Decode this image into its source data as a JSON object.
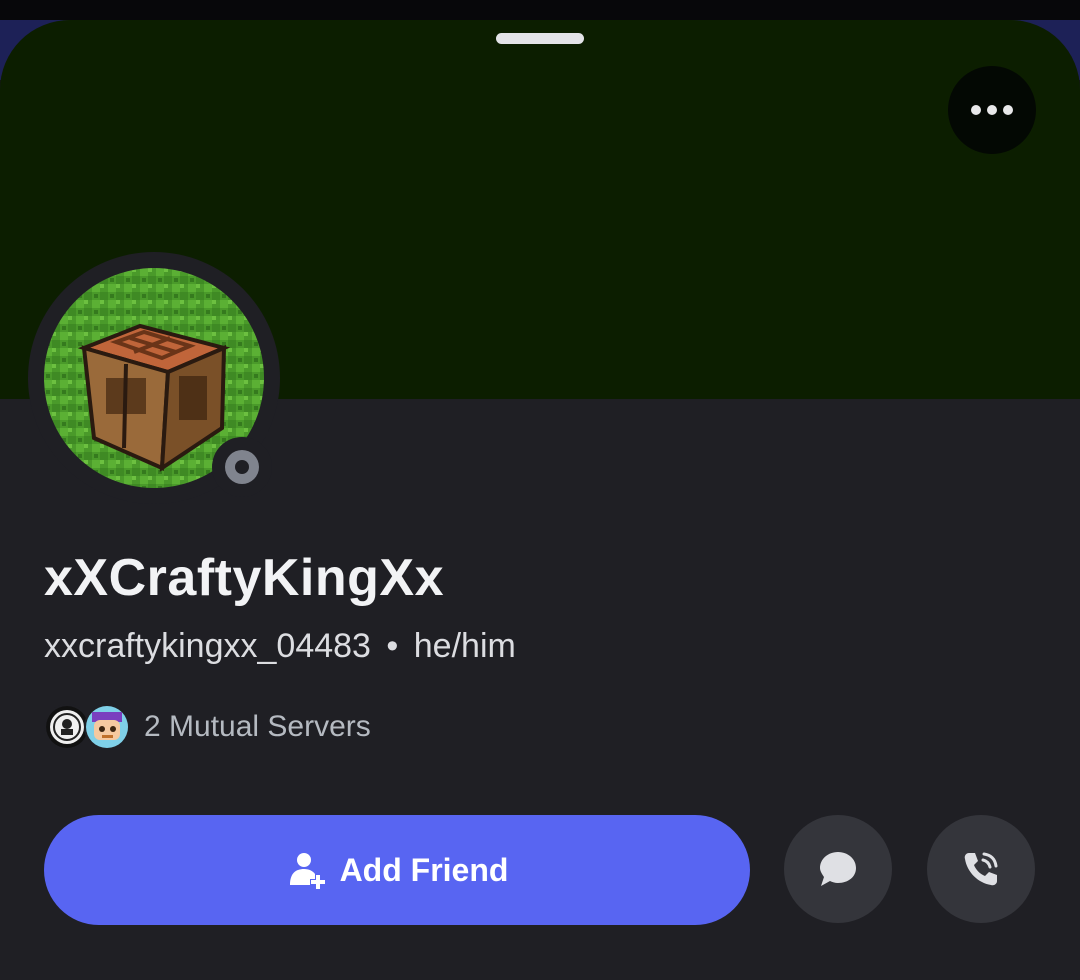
{
  "profile": {
    "display_name": "xXCraftyKingXx",
    "username": "xxcraftykingxx_04483",
    "separator": "•",
    "pronouns": "he/him",
    "status": "offline",
    "mutual_servers_text": "2 Mutual Servers"
  },
  "actions": {
    "add_friend_label": "Add Friend"
  },
  "colors": {
    "banner": "#0c1e00",
    "sheet": "#1f1f24",
    "primary_button": "#5865f2",
    "round_button": "#34353b",
    "status_offline": "#80848e"
  },
  "icons": {
    "more": "more-horizontal-icon",
    "add_friend": "add-user-icon",
    "message": "chat-bubble-icon",
    "call": "phone-icon"
  }
}
